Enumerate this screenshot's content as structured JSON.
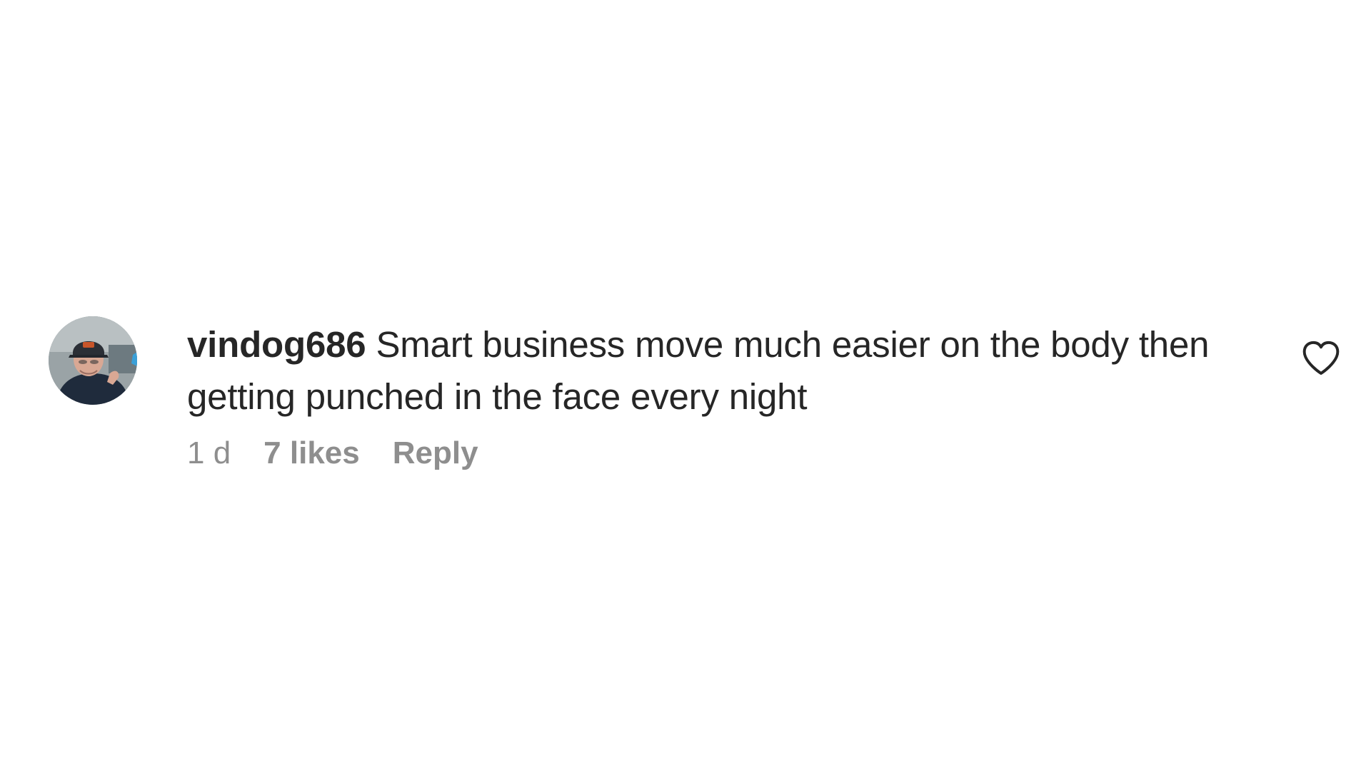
{
  "comment": {
    "username": "vindog686",
    "text": "Smart business move much easier on the body then getting punched in the face every night",
    "age": "1 d",
    "likes": "7 likes",
    "reply_label": "Reply",
    "avatar_icon": "user-avatar",
    "like_icon": "heart-outline-icon"
  },
  "colors": {
    "text": "#262626",
    "meta": "#8e8e8e",
    "background": "#ffffff"
  }
}
